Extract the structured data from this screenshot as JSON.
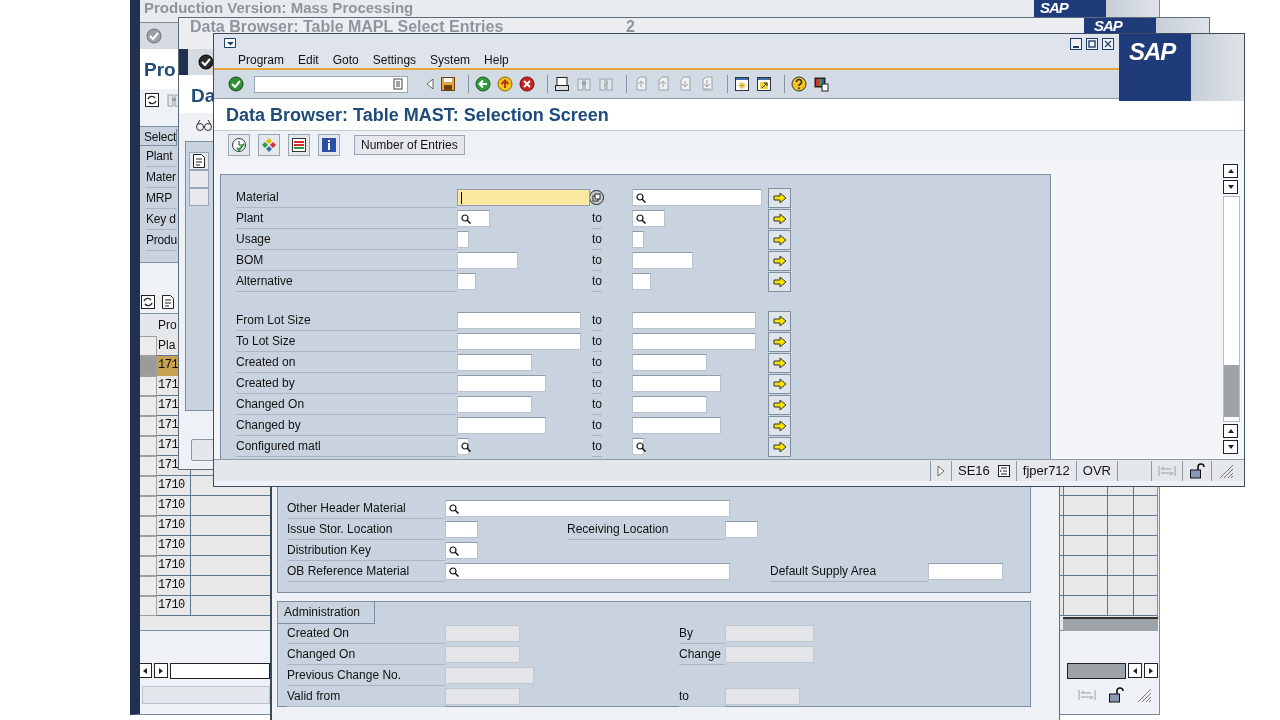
{
  "back_window": {
    "title": "Production Version: Mass Processing",
    "logo": "SAP",
    "heading": "Pro",
    "selection": {
      "title": "Select",
      "labels": [
        "Plant",
        "Mater",
        "MRP",
        "Key d",
        "Produ"
      ]
    },
    "table": {
      "title": "Pro",
      "column": "Pla",
      "rows": [
        {
          "plant": "171",
          "selected": true
        },
        {
          "plant": "171",
          "selected": false
        },
        {
          "plant": "171",
          "selected": false
        },
        {
          "plant": "171",
          "selected": false
        },
        {
          "plant": "171",
          "selected": false
        },
        {
          "plant": "171",
          "selected": false
        },
        {
          "plant": "1710",
          "selected": false
        },
        {
          "plant": "1710",
          "selected": false
        },
        {
          "plant": "1710",
          "selected": false
        },
        {
          "plant": "1710",
          "selected": false
        },
        {
          "plant": "1710",
          "selected": false
        },
        {
          "plant": "1710",
          "selected": false
        },
        {
          "plant": "1710",
          "selected": false
        }
      ]
    }
  },
  "mid_window": {
    "title": "Data Browser: Table MAPL  Select Entries",
    "count": "2",
    "logo": "SAP",
    "heading": "Da"
  },
  "detail_window": {
    "groups": [
      {
        "rows": [
          [
            {
              "label": "Other Header Material",
              "search": true,
              "disabled": false
            }
          ],
          [
            {
              "label": "Issue Stor. Location",
              "search": false,
              "disabled": false
            },
            {
              "label": "Receiving Location",
              "search": false,
              "disabled": false
            }
          ],
          [
            {
              "label": "Distribution Key",
              "search": true,
              "disabled": false
            }
          ],
          [
            {
              "label": "OB Reference Material",
              "search": true,
              "disabled": false
            },
            {
              "label": "Default Supply Area",
              "search": false,
              "disabled": false
            }
          ]
        ]
      },
      {
        "title": "Administration",
        "rows": [
          [
            {
              "label": "Created On",
              "search": false,
              "disabled": true
            },
            {
              "label": "By",
              "search": false,
              "disabled": true
            }
          ],
          [
            {
              "label": "Changed On",
              "search": false,
              "disabled": true
            },
            {
              "label": "Change",
              "search": false,
              "disabled": true
            }
          ],
          [
            {
              "label": "Previous Change No.",
              "search": false,
              "disabled": true
            }
          ],
          [
            {
              "label": "Valid from",
              "search": false,
              "disabled": true
            },
            {
              "label": "to",
              "search": false,
              "disabled": true
            }
          ]
        ]
      }
    ]
  },
  "front_window": {
    "menu": [
      "Program",
      "Edit",
      "Goto",
      "Settings",
      "System",
      "Help"
    ],
    "logo": "SAP",
    "title": "Data Browser: Table MAST: Selection Screen",
    "toolbar_button": "Number of Entries",
    "criteria": [
      [
        {
          "label": "Material",
          "from_search": false,
          "to_search": true,
          "focused": true
        },
        {
          "label": "Plant",
          "from_search": true,
          "to": "to",
          "to_search": true,
          "focused": false
        },
        {
          "label": "Usage",
          "from_search": false,
          "to": "to",
          "to_search": false,
          "focused": false
        },
        {
          "label": "BOM",
          "from_search": false,
          "to": "to",
          "to_search": false,
          "focused": false
        },
        {
          "label": "Alternative",
          "from_search": false,
          "to": "to",
          "to_search": false,
          "focused": false
        }
      ],
      [
        {
          "label": "From Lot Size",
          "from_search": false,
          "to": "to",
          "to_search": false,
          "focused": false
        },
        {
          "label": "To Lot Size",
          "from_search": false,
          "to": "to",
          "to_search": false,
          "focused": false
        },
        {
          "label": "Created on",
          "from_search": false,
          "to": "to",
          "to_search": false,
          "focused": false
        },
        {
          "label": "Created by",
          "from_search": false,
          "to": "to",
          "to_search": false,
          "focused": false
        },
        {
          "label": "Changed On",
          "from_search": false,
          "to": "to",
          "to_search": false,
          "focused": false
        },
        {
          "label": "Changed by",
          "from_search": false,
          "to": "to",
          "to_search": false,
          "focused": false
        },
        {
          "label": "Configured matl",
          "from_search": true,
          "to": "to",
          "to_search": true,
          "focused": false
        }
      ]
    ],
    "status": {
      "transaction": "SE16",
      "server": "fjper712",
      "mode": "OVR"
    }
  }
}
